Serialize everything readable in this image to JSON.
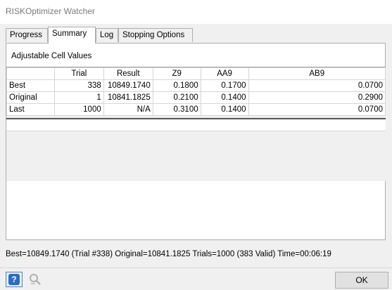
{
  "window": {
    "title": "RISKOptimizer Watcher"
  },
  "tabs": [
    {
      "label": "Progress",
      "active": false
    },
    {
      "label": "Summary",
      "active": true
    },
    {
      "label": "Log",
      "active": false
    },
    {
      "label": "Stopping Options",
      "active": false
    }
  ],
  "summary": {
    "section_label": "Adjustable Cell Values",
    "columns": [
      "",
      "Trial",
      "Result",
      "Z9",
      "AA9",
      "AB9"
    ],
    "rows": [
      [
        "Best",
        "338",
        "10849.1740",
        "0.1800",
        "0.1700",
        "0.0700"
      ],
      [
        "Original",
        "1",
        "10841.1825",
        "0.2100",
        "0.1400",
        "0.2900"
      ],
      [
        "Last",
        "1000",
        "N/A",
        "0.3100",
        "0.1400",
        "0.0700"
      ]
    ]
  },
  "status": {
    "text": "Best=10849.1740 (Trial #338) Original=10841.1825 Trials=1000 (383 Valid) Time=00:06:19"
  },
  "footer": {
    "help_icon": "help-icon",
    "magnify_icon": "magnify-icon",
    "ok_label": "OK"
  }
}
